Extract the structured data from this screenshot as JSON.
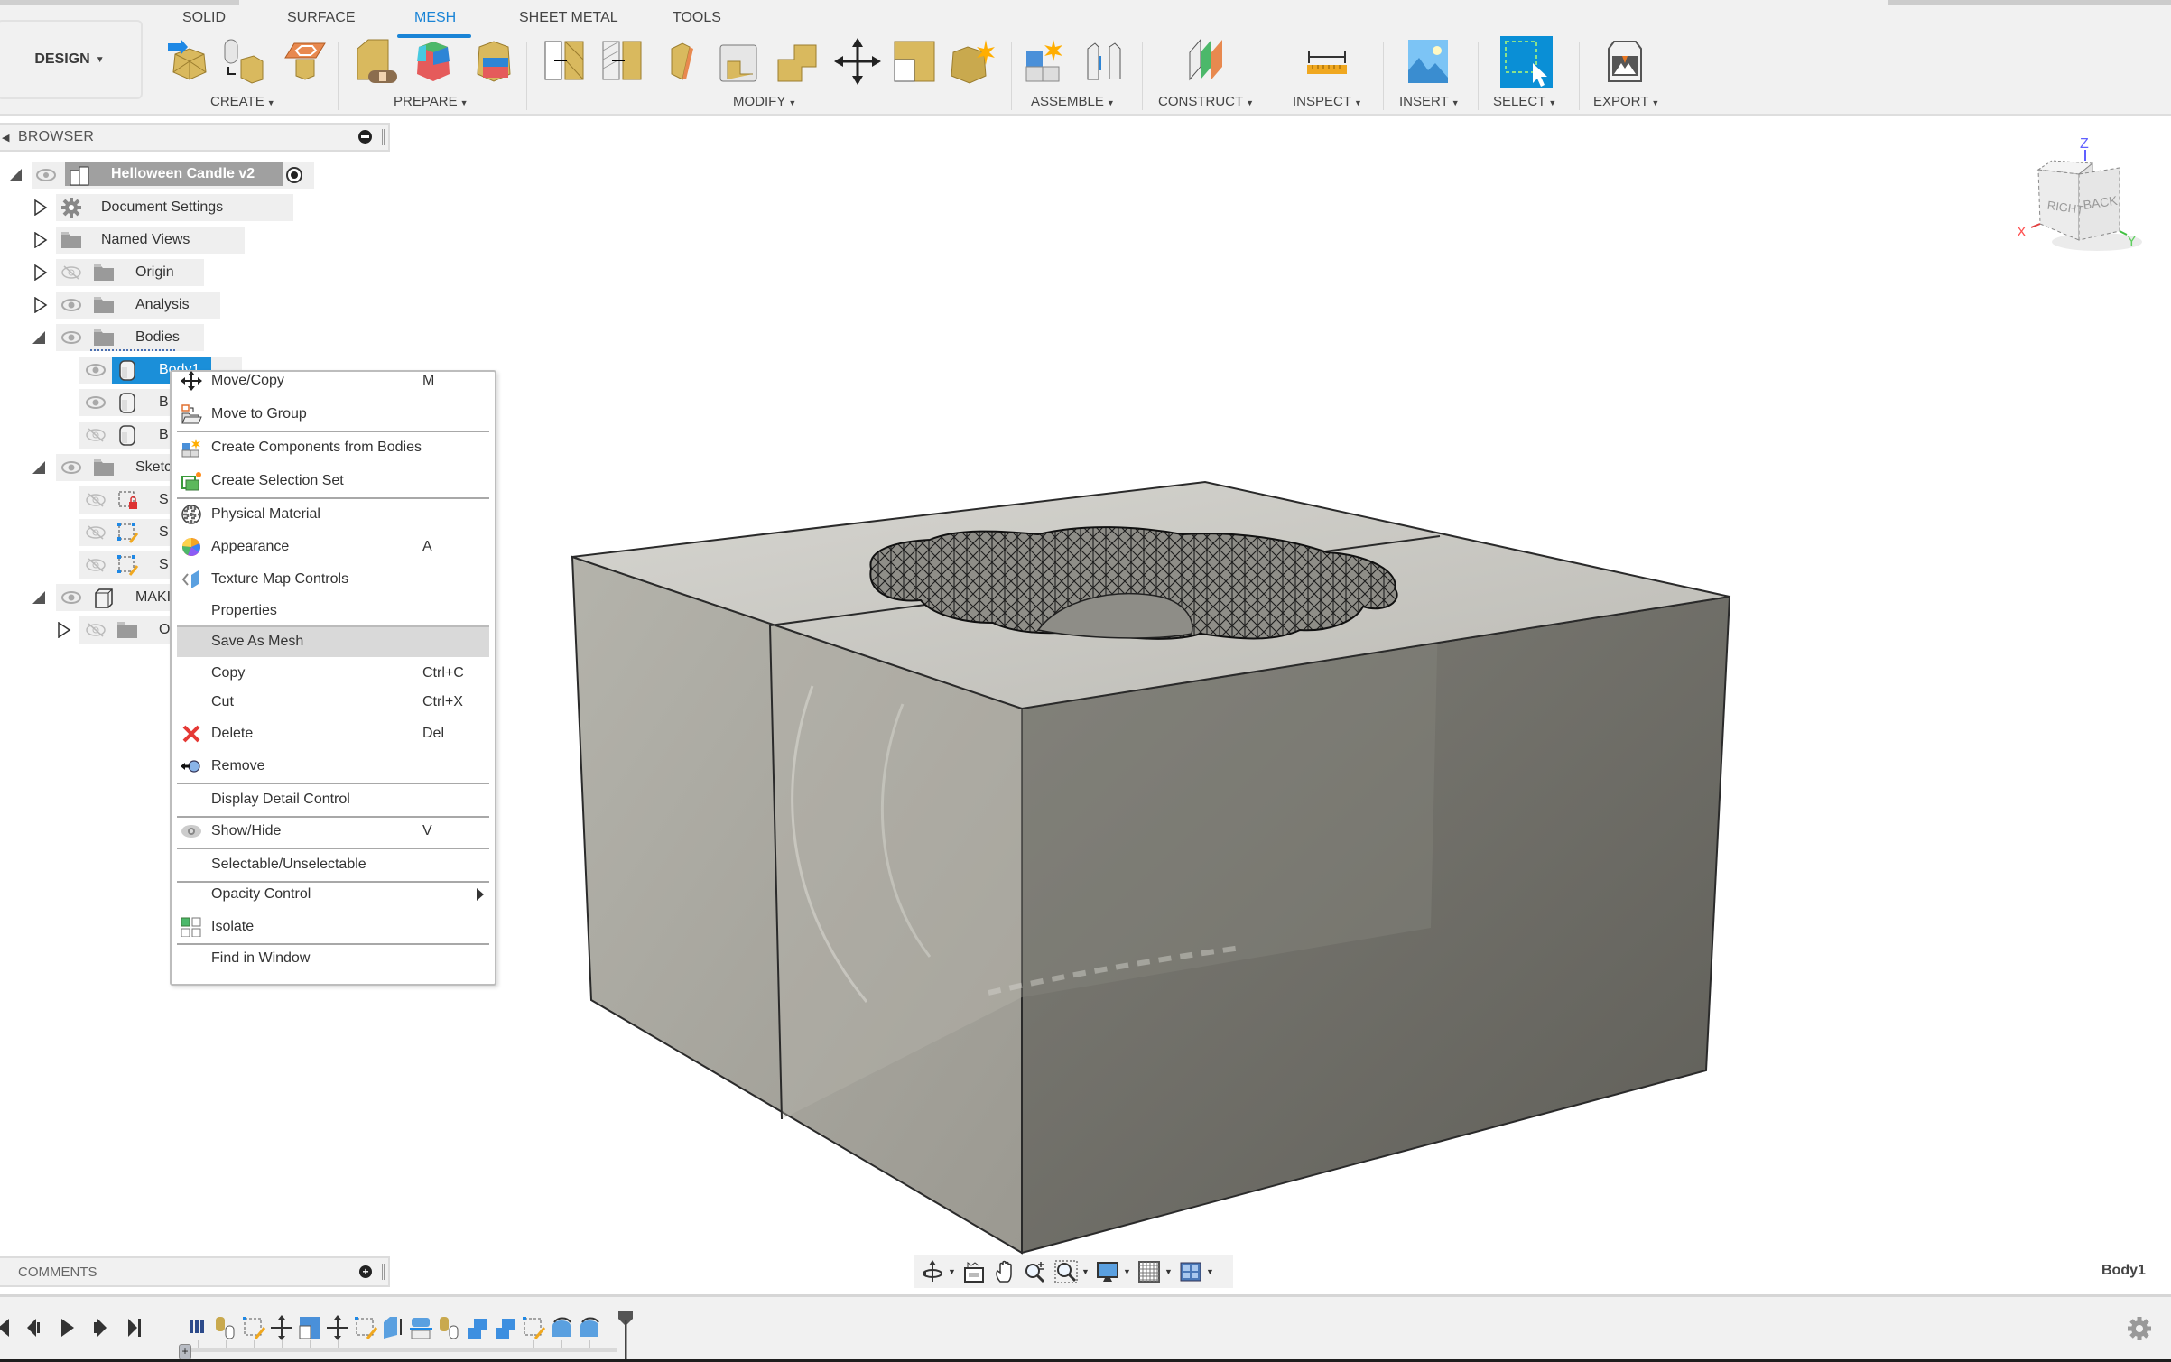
{
  "toolbar": {
    "workspace_button": "DESIGN",
    "tabs": [
      {
        "label": "SOLID",
        "active": false
      },
      {
        "label": "SURFACE",
        "active": false
      },
      {
        "label": "MESH",
        "active": true
      },
      {
        "label": "SHEET METAL",
        "active": false
      },
      {
        "label": "TOOLS",
        "active": false
      }
    ],
    "groups": [
      {
        "label": "CREATE",
        "icons": [
          "insert-mesh-icon",
          "tessellate-icon",
          "create-face-group-icon"
        ]
      },
      {
        "label": "PREPARE",
        "icons": [
          "repair-icon",
          "generate-face-groups-icon",
          "combine-face-groups-icon"
        ]
      },
      {
        "label": "MODIFY",
        "icons": [
          "remesh-icon",
          "reduce-icon",
          "plane-cut-icon",
          "shell-icon",
          "combine-icon",
          "move-copy-icon",
          "separate-icon",
          "convert-mesh-icon"
        ]
      },
      {
        "label": "ASSEMBLE",
        "icons": [
          "new-component-icon",
          "joint-icon"
        ]
      },
      {
        "label": "CONSTRUCT",
        "icons": [
          "offset-plane-icon"
        ]
      },
      {
        "label": "INSPECT",
        "icons": [
          "measure-icon"
        ]
      },
      {
        "label": "INSERT",
        "icons": [
          "insert-image-icon"
        ]
      },
      {
        "label": "SELECT",
        "icons": [
          "select-icon"
        ]
      },
      {
        "label": "EXPORT",
        "icons": [
          "3d-print-icon"
        ]
      }
    ],
    "accent_color": "#1a84d6"
  },
  "browser": {
    "title": "BROWSER",
    "root": {
      "label": "Helloween Candle v2"
    },
    "items": [
      {
        "label": "Document Settings",
        "icon": "gear-icon",
        "expanded": false,
        "visible": null
      },
      {
        "label": "Named Views",
        "icon": "folder-icon",
        "expanded": false,
        "visible": null
      },
      {
        "label": "Origin",
        "icon": "folder-icon",
        "expanded": false,
        "visible": false
      },
      {
        "label": "Analysis",
        "icon": "folder-icon",
        "expanded": false,
        "visible": true
      },
      {
        "label": "Bodies",
        "icon": "folder-icon",
        "expanded": true,
        "visible": true
      },
      {
        "label": "Body1",
        "icon": "body-icon",
        "selected": true,
        "visible": true
      },
      {
        "label": "B",
        "icon": "body-icon",
        "visible": true
      },
      {
        "label": "B",
        "icon": "body-icon",
        "visible": false
      },
      {
        "label": "Sketc",
        "icon": "folder-icon",
        "expanded": true,
        "visible": true
      },
      {
        "label": "S",
        "icon": "sketch-locked-icon",
        "visible": false
      },
      {
        "label": "S",
        "icon": "sketch-icon",
        "visible": false
      },
      {
        "label": "S",
        "icon": "sketch-icon",
        "visible": false
      },
      {
        "label": "MAKI",
        "icon": "component-icon",
        "expanded": true,
        "visible": true
      },
      {
        "label": "O",
        "icon": "folder-icon",
        "expanded": false,
        "visible": false
      }
    ]
  },
  "context_menu": {
    "items": [
      {
        "label": "Move/Copy",
        "shortcut": "M",
        "icon": "move-icon"
      },
      {
        "label": "Move to Group",
        "shortcut": "",
        "icon": "move-to-group-icon"
      },
      {
        "label": "Create Components from Bodies",
        "shortcut": "",
        "icon": "create-components-icon"
      },
      {
        "label": "Create Selection Set",
        "shortcut": "",
        "icon": "selection-set-icon"
      },
      {
        "label": "Physical Material",
        "shortcut": "",
        "icon": "physical-material-icon"
      },
      {
        "label": "Appearance",
        "shortcut": "A",
        "icon": "appearance-icon"
      },
      {
        "label": "Texture Map Controls",
        "shortcut": "",
        "icon": "texture-map-icon"
      },
      {
        "label": "Properties",
        "shortcut": "",
        "icon": ""
      },
      {
        "label": "Save As Mesh",
        "shortcut": "",
        "icon": "",
        "hovered": true
      },
      {
        "label": "Copy",
        "shortcut": "Ctrl+C",
        "icon": ""
      },
      {
        "label": "Cut",
        "shortcut": "Ctrl+X",
        "icon": ""
      },
      {
        "label": "Delete",
        "shortcut": "Del",
        "icon": "delete-icon"
      },
      {
        "label": "Remove",
        "shortcut": "",
        "icon": "remove-icon"
      },
      {
        "label": "Display Detail Control",
        "shortcut": "",
        "icon": ""
      },
      {
        "label": "Show/Hide",
        "shortcut": "V",
        "icon": "eye-icon"
      },
      {
        "label": "Selectable/Unselectable",
        "shortcut": "",
        "icon": ""
      },
      {
        "label": "Opacity Control",
        "shortcut": "",
        "icon": "",
        "submenu": true
      },
      {
        "label": "Isolate",
        "shortcut": "",
        "icon": "isolate-icon"
      },
      {
        "label": "Find in Window",
        "shortcut": "",
        "icon": ""
      }
    ]
  },
  "viewcube": {
    "faces": [
      "RIGHT",
      "BACK"
    ],
    "axes": [
      "X",
      "Y",
      "Z"
    ]
  },
  "comments": {
    "title": "COMMENTS"
  },
  "status": {
    "selection": "Body1"
  },
  "nav_bar": {
    "tools": [
      "orbit-icon",
      "look-at-icon",
      "pan-icon",
      "zoom-icon",
      "fit-icon",
      "display-settings-icon",
      "grid-icon",
      "viewports-icon"
    ]
  },
  "timeline": {
    "feature_count": 15
  }
}
